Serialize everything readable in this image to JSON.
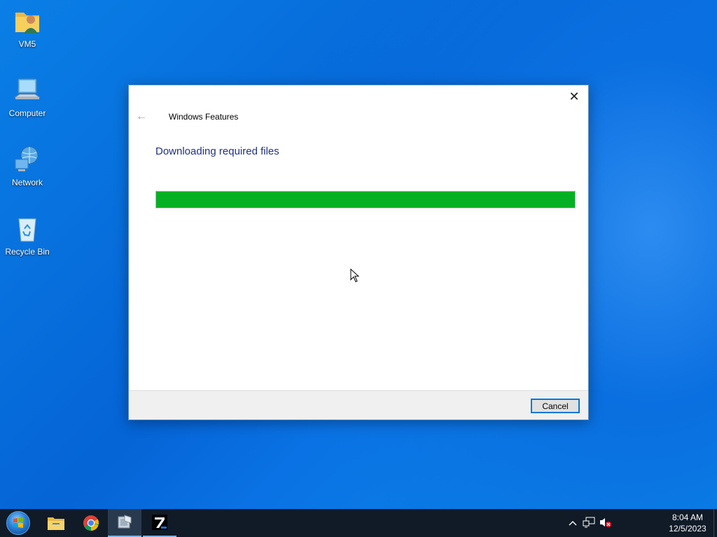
{
  "desktop": {
    "icons": [
      {
        "label": "VM5",
        "icon": "user-folder-icon"
      },
      {
        "label": "Computer",
        "icon": "computer-icon"
      },
      {
        "label": "Network",
        "icon": "network-icon"
      },
      {
        "label": "Recycle Bin",
        "icon": "recycle-bin-icon"
      }
    ]
  },
  "dialog": {
    "title": "Windows Features",
    "heading": "Downloading required files",
    "progress": 1.0,
    "progress_color": "#06b025",
    "cancel_label": "Cancel",
    "close_glyph": "✕",
    "back_glyph": "←"
  },
  "taskbar": {
    "items": [
      {
        "icon": "start-button-icon"
      },
      {
        "icon": "file-explorer-icon"
      },
      {
        "icon": "chrome-icon"
      },
      {
        "icon": "windows-features-icon",
        "active": true
      },
      {
        "icon": "7zip-icon",
        "running": true
      }
    ],
    "tray": {
      "chevron_glyph": "^",
      "time": "8:04 AM",
      "date": "12/5/2023"
    }
  },
  "colors": {
    "accent": "#0078d7",
    "heading": "#1e3287",
    "taskbar": "#101b27"
  }
}
